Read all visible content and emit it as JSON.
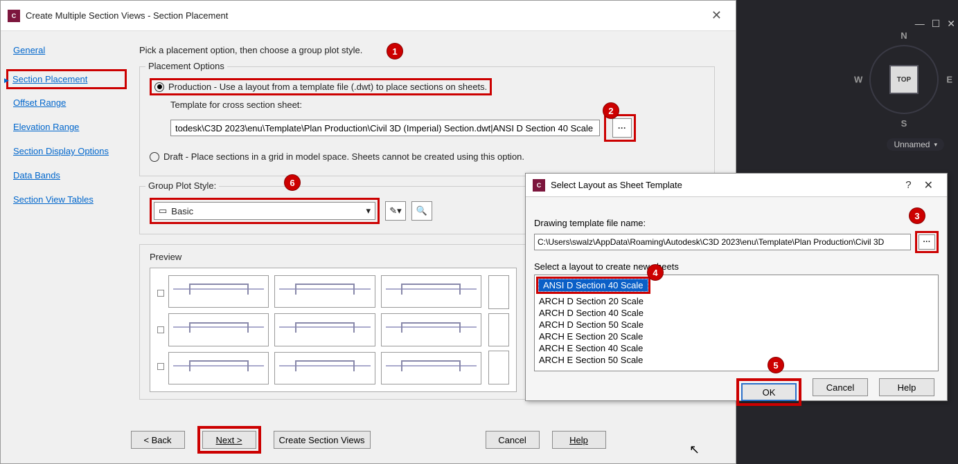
{
  "mainDialog": {
    "title": "Create Multiple Section Views - Section Placement",
    "sidebar": {
      "general": "General",
      "sectionPlacement": "Section Placement",
      "offsetRange": "Offset Range",
      "elevationRange": "Elevation Range",
      "sectionDisplayOptions": "Section Display Options",
      "dataBands": "Data Bands",
      "sectionViewTables": "Section View Tables"
    },
    "instruction": "Pick a placement option, then choose a group plot style.",
    "placementOptionsLabel": "Placement Options",
    "productionLabel": "Production - Use a layout from a template file (.dwt) to place sections on sheets.",
    "templateLabel": "Template for cross section sheet:",
    "templateValue": "todesk\\C3D 2023\\enu\\Template\\Plan Production\\Civil 3D (Imperial) Section.dwt|ANSI D Section 40 Scale",
    "draftLabel": "Draft - Place sections in a grid in model space. Sheets cannot be created using this option.",
    "groupPlotLabel": "Group Plot Style:",
    "groupPlotValue": "Basic",
    "previewLabel": "Preview",
    "buttons": {
      "back": "< Back",
      "next": "Next >",
      "create": "Create Section Views",
      "cancel": "Cancel",
      "help": "Help"
    }
  },
  "sheetDialog": {
    "title": "Select Layout as Sheet Template",
    "fileLabel": "Drawing template file name:",
    "fileValue": "C:\\Users\\swalz\\AppData\\Roaming\\Autodesk\\C3D 2023\\enu\\Template\\Plan Production\\Civil 3D",
    "layoutLabel": "Select a layout to create new sheets",
    "layouts": [
      "ANSI D Section 40 Scale",
      "ARCH D Section 20 Scale",
      "ARCH D Section 40 Scale",
      "ARCH D Section 50 Scale",
      "ARCH E Section 20 Scale",
      "ARCH E Section 40 Scale",
      "ARCH E Section 50 Scale"
    ],
    "buttons": {
      "ok": "OK",
      "cancel": "Cancel",
      "help": "Help"
    }
  },
  "viewcube": {
    "top": "TOP",
    "n": "N",
    "s": "S",
    "e": "E",
    "w": "W",
    "unnamed": "Unnamed"
  },
  "badges": {
    "b1": "1",
    "b2": "2",
    "b3": "3",
    "b4": "4",
    "b5": "5",
    "b6": "6"
  }
}
